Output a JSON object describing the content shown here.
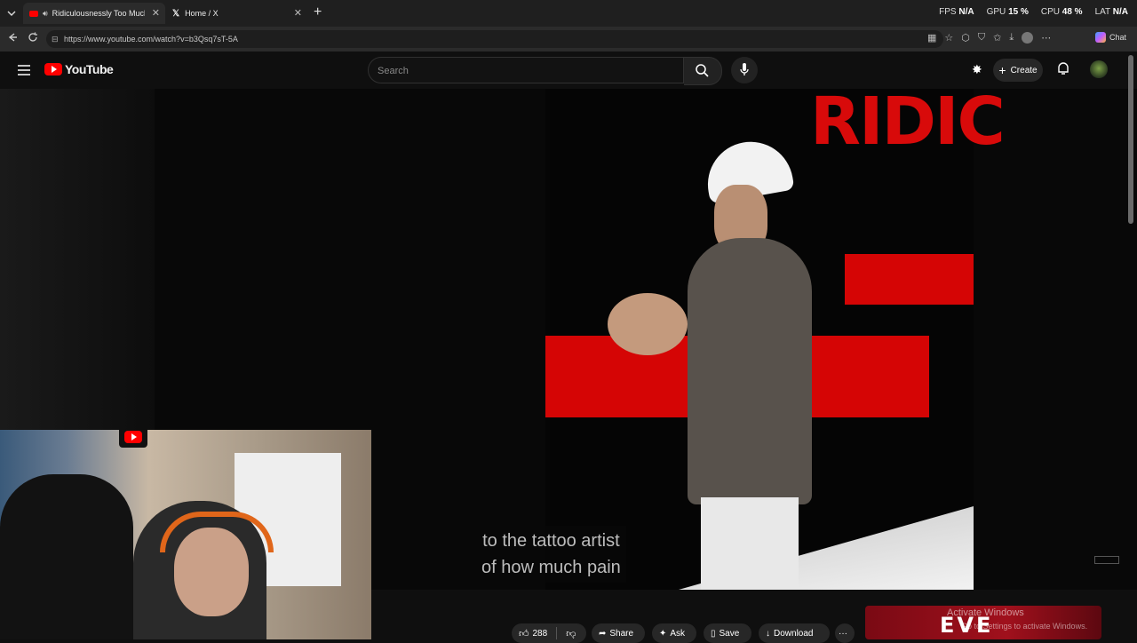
{
  "browser": {
    "tabs": [
      {
        "title": "Ridiculousnessly Too Much G",
        "active": true
      },
      {
        "title": "Home / X",
        "active": false
      }
    ],
    "new_tab_label": "+",
    "stats": [
      {
        "label": "FPS",
        "value": "N/A"
      },
      {
        "label": "GPU",
        "value": "15 %"
      },
      {
        "label": "CPU",
        "value": "48 %"
      },
      {
        "label": "LAT",
        "value": "N/A"
      }
    ],
    "url": "https://www.youtube.com/watch?v=b3Qsq7sT-5A",
    "chat_label": "Chat"
  },
  "youtube": {
    "logo_text": "YouTube",
    "search_placeholder": "Search",
    "create_label": "Create"
  },
  "video": {
    "backdrop_text": "RIDIC",
    "caption_line1": "to the tattoo artist",
    "caption_line2": "of how much pain"
  },
  "actions": {
    "like_count": "288",
    "share_label": "Share",
    "ask_label": "Ask",
    "save_label": "Save",
    "download_label": "Download",
    "more_label": "···"
  },
  "overlay": {
    "ad_logo": "EVE",
    "activate_line1": "Activate Windows",
    "activate_line2": "Go to Settings to activate Windows."
  },
  "colors": {
    "accent_red": "#ff0000",
    "stage_red": "#d50505",
    "background": "#0f0f0f"
  }
}
